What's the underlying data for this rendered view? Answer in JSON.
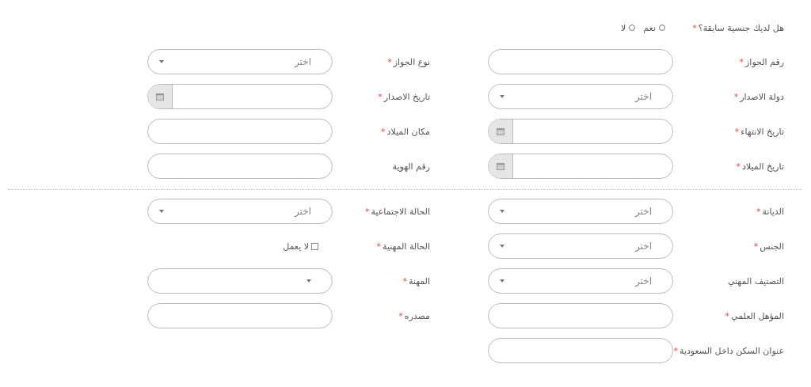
{
  "question": {
    "label": "هل لديك جنسية سابقة؟",
    "mark": "*",
    "options": [
      {
        "label": "نعم",
        "selected": false
      },
      {
        "label": "لا",
        "selected": false
      }
    ]
  },
  "sections": [
    {
      "rows": [
        {
          "right": {
            "kind": "text",
            "label": "رقم الجواز",
            "mark": "*"
          },
          "left": {
            "kind": "select",
            "label": "نوع الجواز",
            "mark": "*",
            "placeholder": "اختر"
          }
        },
        {
          "right": {
            "kind": "select",
            "label": "دولة الاصدار",
            "mark": "*",
            "placeholder": "اختر"
          },
          "left": {
            "kind": "date",
            "label": "تاريخ الاصدار",
            "mark": "*"
          }
        },
        {
          "right": {
            "kind": "date",
            "label": "تاريخ الانتهاء",
            "mark": "*"
          },
          "left": {
            "kind": "text",
            "label": "مكان الميلاد",
            "mark": "*"
          }
        },
        {
          "right": {
            "kind": "date",
            "label": "تاريخ الميلاد",
            "mark": "*"
          },
          "left": {
            "kind": "text",
            "label": "رقم الهوية"
          }
        }
      ]
    },
    {
      "rows": [
        {
          "right": {
            "kind": "select",
            "label": "الديانة",
            "mark": "*",
            "placeholder": "اختر"
          },
          "left": {
            "kind": "select",
            "label": "الحالة الاجتماعية",
            "mark": "*",
            "placeholder": "اختر"
          }
        },
        {
          "right": {
            "kind": "select",
            "label": "الجنس",
            "mark": "*",
            "placeholder": "اختر"
          },
          "left": {
            "kind": "checkbox",
            "label": "الحالة المهنية",
            "mark": "*",
            "option": "لا يعمل",
            "checked": false
          }
        },
        {
          "right": {
            "kind": "select",
            "label": "التصنيف المهني",
            "placeholder": "اختر"
          },
          "left": {
            "kind": "select",
            "label": "المهنة",
            "mark": "*"
          }
        },
        {
          "right": {
            "kind": "text",
            "label": "المؤهل العلمي",
            "mark": "*"
          },
          "left": {
            "kind": "text",
            "label": "مصدره",
            "mark": "*"
          }
        },
        {
          "right": {
            "kind": "text",
            "label": "عنوان السكن داخل السعودية",
            "mark": "*"
          }
        }
      ]
    }
  ]
}
